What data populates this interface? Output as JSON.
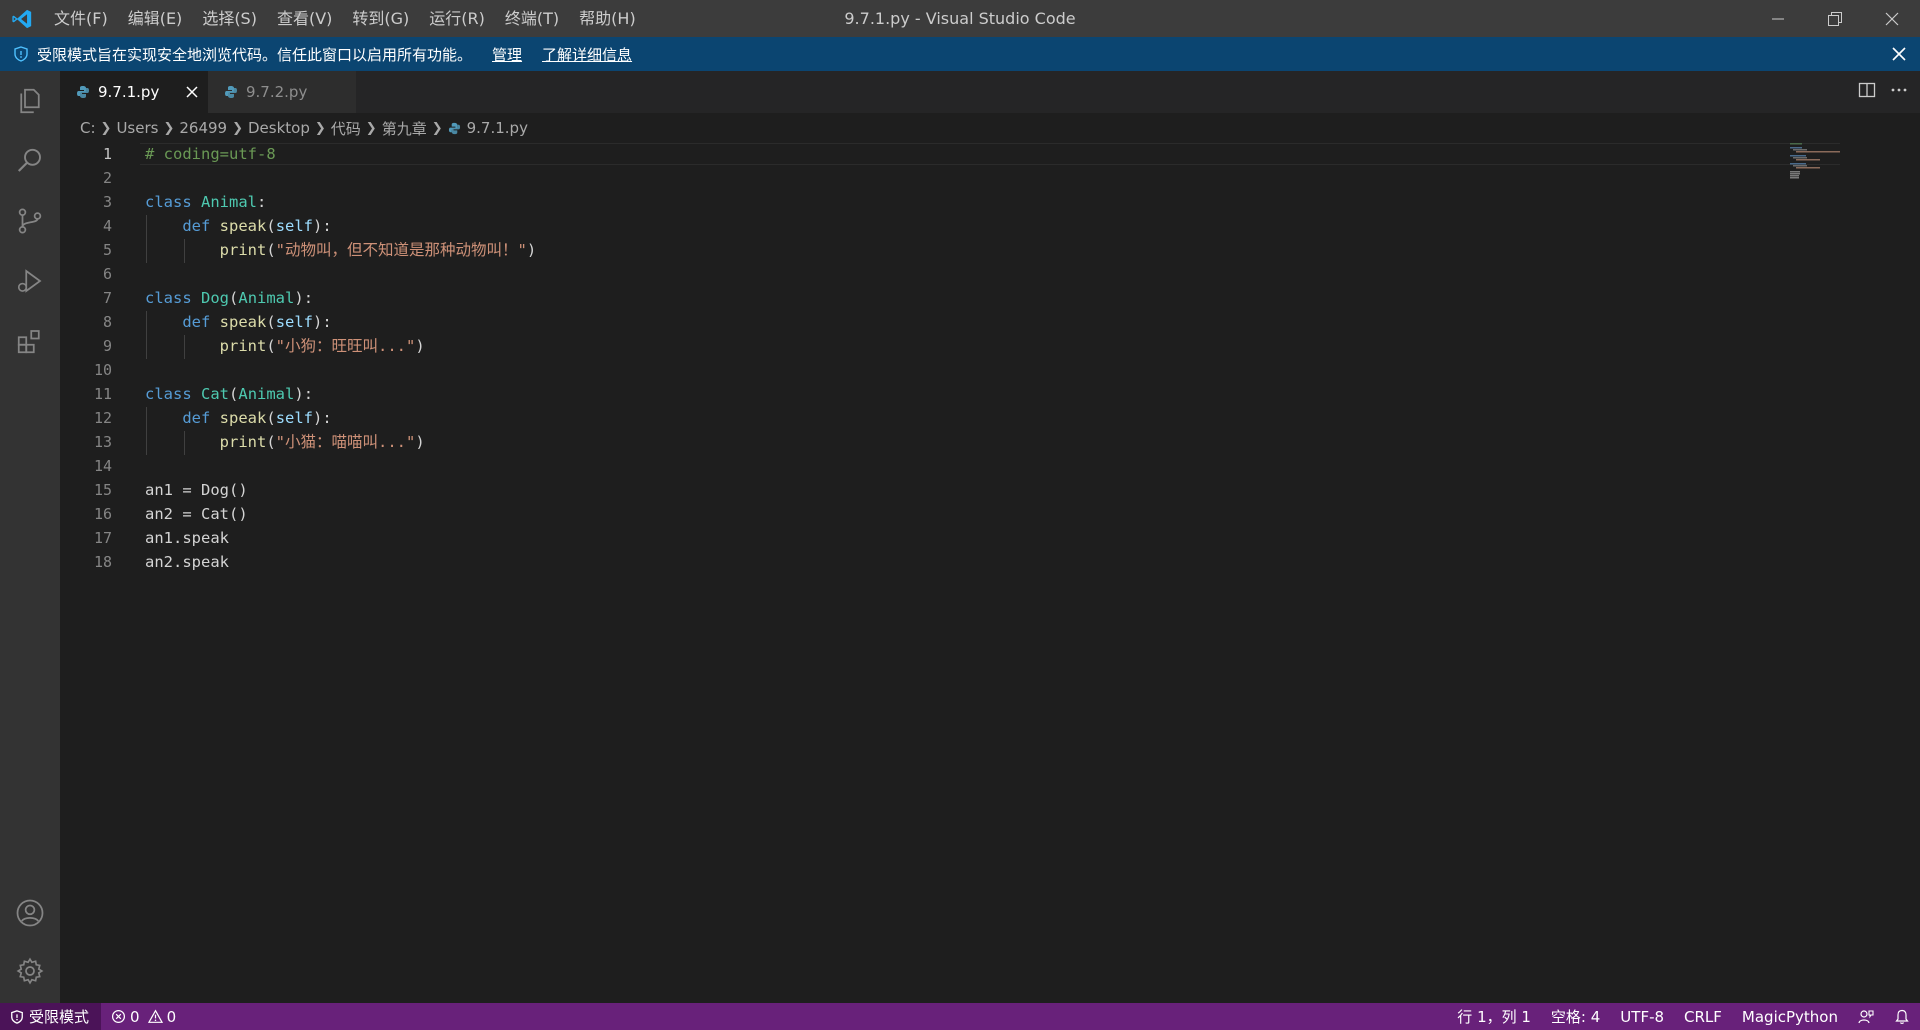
{
  "window": {
    "title": "9.7.1.py - Visual Studio Code"
  },
  "menu": [
    "文件(F)",
    "编辑(E)",
    "选择(S)",
    "查看(V)",
    "转到(G)",
    "运行(R)",
    "终端(T)",
    "帮助(H)"
  ],
  "banner": {
    "text": "受限模式旨在实现安全地浏览代码。信任此窗口以启用所有功能。",
    "manage": "管理",
    "learn_more": "了解详细信息"
  },
  "tabs": [
    {
      "label": "9.7.1.py",
      "active": true
    },
    {
      "label": "9.7.2.py",
      "active": false
    }
  ],
  "breadcrumb": [
    "C:",
    "Users",
    "26499",
    "Desktop",
    "代码",
    "第九章",
    "9.7.1.py"
  ],
  "editor": {
    "line_numbers": [
      "1",
      "2",
      "3",
      "4",
      "5",
      "6",
      "7",
      "8",
      "9",
      "10",
      "11",
      "12",
      "13",
      "14",
      "15",
      "16",
      "17",
      "18"
    ],
    "code": {
      "l1": "# coding=utf-8",
      "kw_class": "class",
      "kw_def": "def",
      "cls_animal": "Animal",
      "cls_dog": "Dog",
      "cls_cat": "Cat",
      "fn_speak": "speak",
      "param_self": "self",
      "fn_print": "print",
      "str1": "\"动物叫，但不知道是那种动物叫！\"",
      "str2": "\"小狗：旺旺叫...\"",
      "str3": "\"小猫：喵喵叫...\"",
      "l15": "an1 = Dog()",
      "l16": "an2 = Cat()",
      "l17": "an1.speak",
      "l18": "an2.speak"
    }
  },
  "status": {
    "restricted": "受限模式",
    "errors": "0",
    "warnings": "0",
    "position": "行 1，列 1",
    "spaces": "空格: 4",
    "encoding": "UTF-8",
    "eol": "CRLF",
    "language": "MagicPython"
  },
  "colors": {
    "statusbar": "#68217a",
    "banner": "#0b4571",
    "accent": "#007acc"
  }
}
